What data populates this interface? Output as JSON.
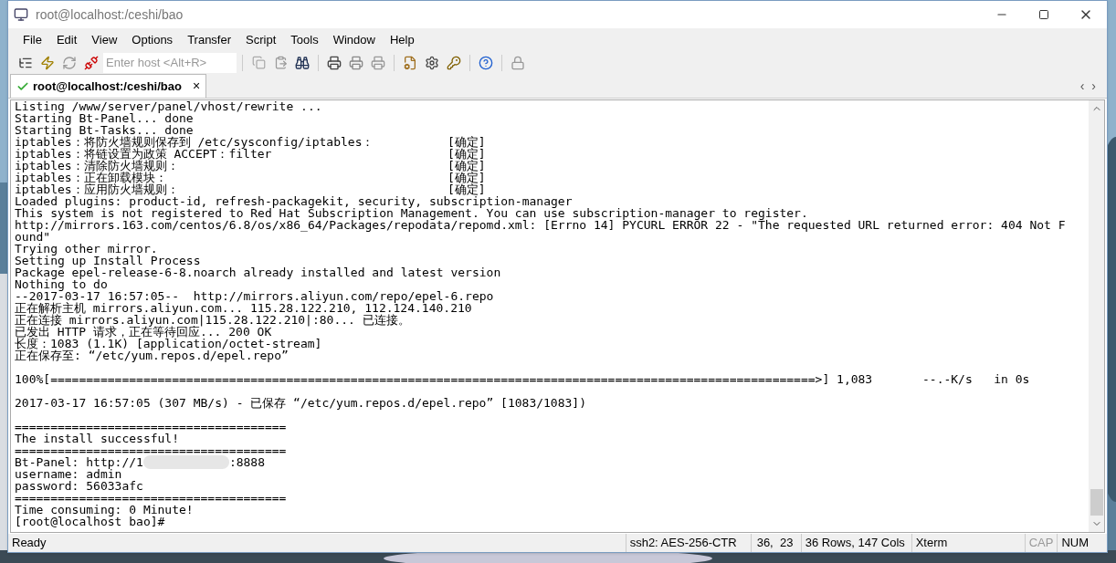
{
  "window": {
    "title": "root@localhost:/ceshi/bao"
  },
  "menu": [
    "File",
    "Edit",
    "View",
    "Options",
    "Transfer",
    "Script",
    "Tools",
    "Window",
    "Help"
  ],
  "toolbar": {
    "host_field": {
      "placeholder": "Enter host <Alt+R>"
    }
  },
  "tabs": [
    {
      "label": "root@localhost:/ceshi/bao",
      "selected": true,
      "connected": true,
      "close": "×"
    }
  ],
  "tab_nav": [
    "‹",
    "›"
  ],
  "terminal": {
    "lines": [
      {
        "kind": "text",
        "text": "Listing /www/server/panel/vhost/rewrite ..."
      },
      {
        "kind": "text",
        "text": "Starting Bt-Panel... done"
      },
      {
        "kind": "text",
        "text": "Starting Bt-Tasks... done"
      },
      {
        "kind": "status",
        "text": "iptables：将防火墙规则保存到 /etc/sysconfig/iptables：",
        "status": "[确定]"
      },
      {
        "kind": "status",
        "text": "iptables：将链设置为政策 ACCEPT：filter",
        "status": "[确定]"
      },
      {
        "kind": "status",
        "text": "iptables：清除防火墙规则：",
        "status": "[确定]"
      },
      {
        "kind": "status",
        "text": "iptables：正在卸载模块：",
        "status": "[确定]"
      },
      {
        "kind": "status",
        "text": "iptables：应用防火墙规则：",
        "status": "[确定]"
      },
      {
        "kind": "text",
        "text": "Loaded plugins: product-id, refresh-packagekit, security, subscription-manager"
      },
      {
        "kind": "text",
        "text": "This system is not registered to Red Hat Subscription Management. You can use subscription-manager to register."
      },
      {
        "kind": "text",
        "text": "http://mirrors.163.com/centos/6.8/os/x86_64/Packages/repodata/repomd.xml: [Errno 14] PYCURL ERROR 22 - \"The requested URL returned error: 404 Not F"
      },
      {
        "kind": "text",
        "text": "ound\""
      },
      {
        "kind": "text",
        "text": "Trying other mirror."
      },
      {
        "kind": "text",
        "text": "Setting up Install Process"
      },
      {
        "kind": "text",
        "text": "Package epel-release-6-8.noarch already installed and latest version"
      },
      {
        "kind": "text",
        "text": "Nothing to do"
      },
      {
        "kind": "text",
        "text": "--2017-03-17 16:57:05--  http://mirrors.aliyun.com/repo/epel-6.repo"
      },
      {
        "kind": "text",
        "text": "正在解析主机 mirrors.aliyun.com... 115.28.122.210, 112.124.140.210"
      },
      {
        "kind": "text",
        "text": "正在连接 mirrors.aliyun.com|115.28.122.210|:80... 已连接。"
      },
      {
        "kind": "text",
        "text": "已发出 HTTP 请求，正在等待回应... 200 OK"
      },
      {
        "kind": "text",
        "text": "长度：1083 (1.1K) [application/octet-stream]"
      },
      {
        "kind": "text",
        "text": "正在保存至: “/etc/yum.repos.d/epel.repo”"
      },
      {
        "kind": "blank"
      },
      {
        "kind": "text",
        "text": "100%[===========================================================================================================>] 1,083       --.-K/s   in 0s"
      },
      {
        "kind": "blank"
      },
      {
        "kind": "text",
        "text": "2017-03-17 16:57:05 (307 MB/s) - 已保存 “/etc/yum.repos.d/epel.repo” [1083/1083])"
      },
      {
        "kind": "blank"
      },
      {
        "kind": "text",
        "text": "======================================"
      },
      {
        "kind": "text",
        "text": "The install successful!"
      },
      {
        "kind": "text",
        "text": "======================================"
      },
      {
        "kind": "redacted",
        "before": "Bt-Panel: http://1",
        "after": ":8888"
      },
      {
        "kind": "text",
        "text": "username: admin"
      },
      {
        "kind": "text",
        "text": "password: 56033afc"
      },
      {
        "kind": "text",
        "text": "======================================"
      },
      {
        "kind": "text",
        "text": "Time consuming: 0 Minute!"
      },
      {
        "kind": "text",
        "text": "[root@localhost bao]#"
      }
    ]
  },
  "status_bar": {
    "message": "Ready",
    "cipher": "ssh2: AES-256-CTR",
    "cursor": "36,  23",
    "size": "36 Rows, 147 Cols",
    "terminal_type": "Xterm",
    "keys": [
      {
        "label": "CAP",
        "on": false
      },
      {
        "label": "NUM",
        "on": true
      }
    ]
  }
}
